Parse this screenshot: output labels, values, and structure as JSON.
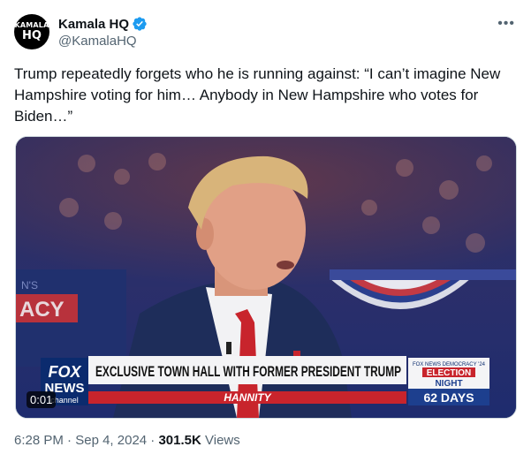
{
  "account": {
    "display_name": "Kamala HQ",
    "handle": "@KamalaHQ",
    "avatar_line1": "KAMALA",
    "avatar_line2": "HQ",
    "verified_color": "#1d9bf0"
  },
  "tweet": {
    "text": "Trump repeatedly forgets who he is running against: “I can’t imagine New Hampshire voting for him… Anybody in New Hampshire who votes for Biden…”",
    "time": "6:28 PM",
    "date": "Sep 4, 2024",
    "views_count": "301.5K",
    "views_label": "Views"
  },
  "video": {
    "duration": "0:01",
    "chyron_headline": "EXCLUSIVE TOWN HALL WITH FORMER PRESIDENT TRUMP",
    "chyron_show": "HANNITY",
    "logo_fox": "FOX",
    "logo_news": "NEWS",
    "logo_channel": "channel",
    "election_small": "FOX NEWS DEMOCRACY '24",
    "election_line1": "ELECTION",
    "election_line2": "NIGHT",
    "election_days": "62 DAYS",
    "bg_sign": "ACY",
    "bg_sign_small": "N'S"
  },
  "ui": {
    "more_icon": "ellipsis-icon"
  }
}
